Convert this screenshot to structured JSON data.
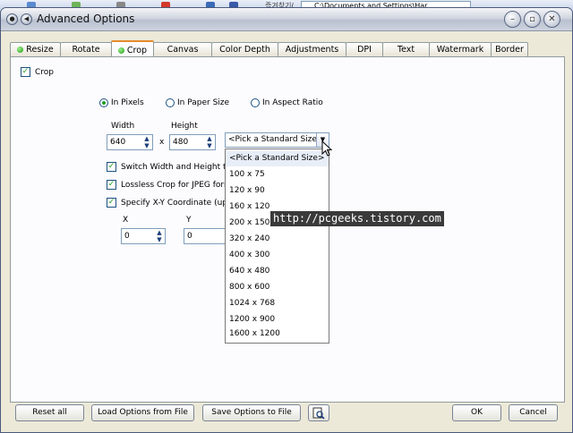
{
  "background_app": {
    "korean_menu": "즐겨찾기(",
    "address": "C:\\Documents and Settings\\Har"
  },
  "window": {
    "title": "Advanced Options"
  },
  "tabs": [
    {
      "label": "Resize",
      "dot": true
    },
    {
      "label": "Rotate",
      "dot": false
    },
    {
      "label": "Crop",
      "dot": true,
      "active": true
    },
    {
      "label": "Canvas",
      "dot": false
    },
    {
      "label": "Color Depth",
      "dot": false
    },
    {
      "label": "Adjustments",
      "dot": false
    },
    {
      "label": "DPI",
      "dot": false
    },
    {
      "label": "Text",
      "dot": false
    },
    {
      "label": "Watermark",
      "dot": false
    },
    {
      "label": "Border",
      "dot": false
    }
  ],
  "crop": {
    "enable_label": "Crop",
    "enabled": true,
    "units": {
      "pixels": "In Pixels",
      "paper": "In Paper Size",
      "aspect": "In Aspect Ratio",
      "selected": "pixels"
    },
    "width_label": "Width",
    "height_label": "Height",
    "width_value": "640",
    "height_value": "480",
    "times": "x",
    "standard_size_value": "<Pick a Standard Size>",
    "switch_label": "Switch Width and Height to m",
    "lossless_label": "Lossless Crop for JPEG form",
    "xy_label": "Specify X-Y Coordinate (upp",
    "x_label": "X",
    "y_label": "Y",
    "x_value": "0",
    "y_value": "0"
  },
  "dropdown_options": [
    "<Pick a Standard Size>",
    "100 x 75",
    "120 x 90",
    "160 x 120",
    "200 x 150",
    "320 x 240",
    "400 x 300",
    "640 x 480",
    "800 x 600",
    "1024 x 768",
    "1200 x 900",
    "1600 x 1200"
  ],
  "watermark_text": "http://pcgeeks.tistory.com",
  "buttons": {
    "reset": "Reset all",
    "load": "Load Options from File",
    "save": "Save Options to File",
    "ok": "OK",
    "cancel": "Cancel"
  },
  "colors": {
    "accent_green": "#21a121",
    "tab_active_border": "#e68b2c"
  }
}
